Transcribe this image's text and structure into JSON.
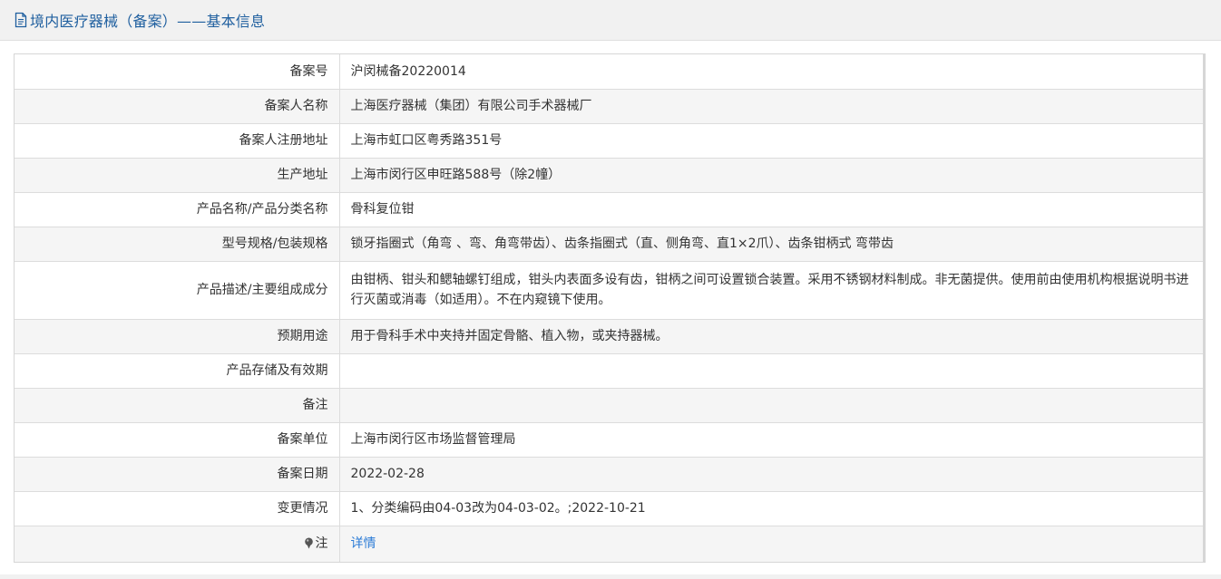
{
  "header": {
    "title": "境内医疗器械（备案）——基本信息",
    "icon": "document-icon",
    "title_color": "#1f5f9f"
  },
  "rows": [
    {
      "label": "备案号",
      "value": "沪闵械备20220014"
    },
    {
      "label": "备案人名称",
      "value": "上海医疗器械（集团）有限公司手术器械厂"
    },
    {
      "label": "备案人注册地址",
      "value": "上海市虹口区粤秀路351号"
    },
    {
      "label": "生产地址",
      "value": "上海市闵行区申旺路588号（除2幢）"
    },
    {
      "label": "产品名称/产品分类名称",
      "value": "骨科复位钳"
    },
    {
      "label": "型号规格/包装规格",
      "value": "锁牙指圈式（角弯 、弯、角弯带齿）、齿条指圈式（直、侧角弯、直1×2爪）、齿条钳柄式 弯带齿"
    },
    {
      "label": "产品描述/主要组成成分",
      "value": "由钳柄、钳头和鳃轴螺钉组成，钳头内表面多设有齿，钳柄之间可设置锁合装置。采用不锈钢材料制成。非无菌提供。使用前由使用机构根据说明书进行灭菌或消毒（如适用）。不在内窥镜下使用。"
    },
    {
      "label": "预期用途",
      "value": "用于骨科手术中夹持并固定骨骼、植入物，或夹持器械。"
    },
    {
      "label": "产品存储及有效期",
      "value": ""
    },
    {
      "label": "备注",
      "value": ""
    },
    {
      "label": "备案单位",
      "value": "上海市闵行区市场监督管理局"
    },
    {
      "label": "备案日期",
      "value": "2022-02-28"
    },
    {
      "label": "变更情况",
      "value": "1、分类编码由04-03改为04-03-02。;2022-10-21"
    }
  ],
  "note_row": {
    "label": "注",
    "icon": "pin-icon",
    "link_text": "详情",
    "link_color": "#2b7bd6"
  }
}
